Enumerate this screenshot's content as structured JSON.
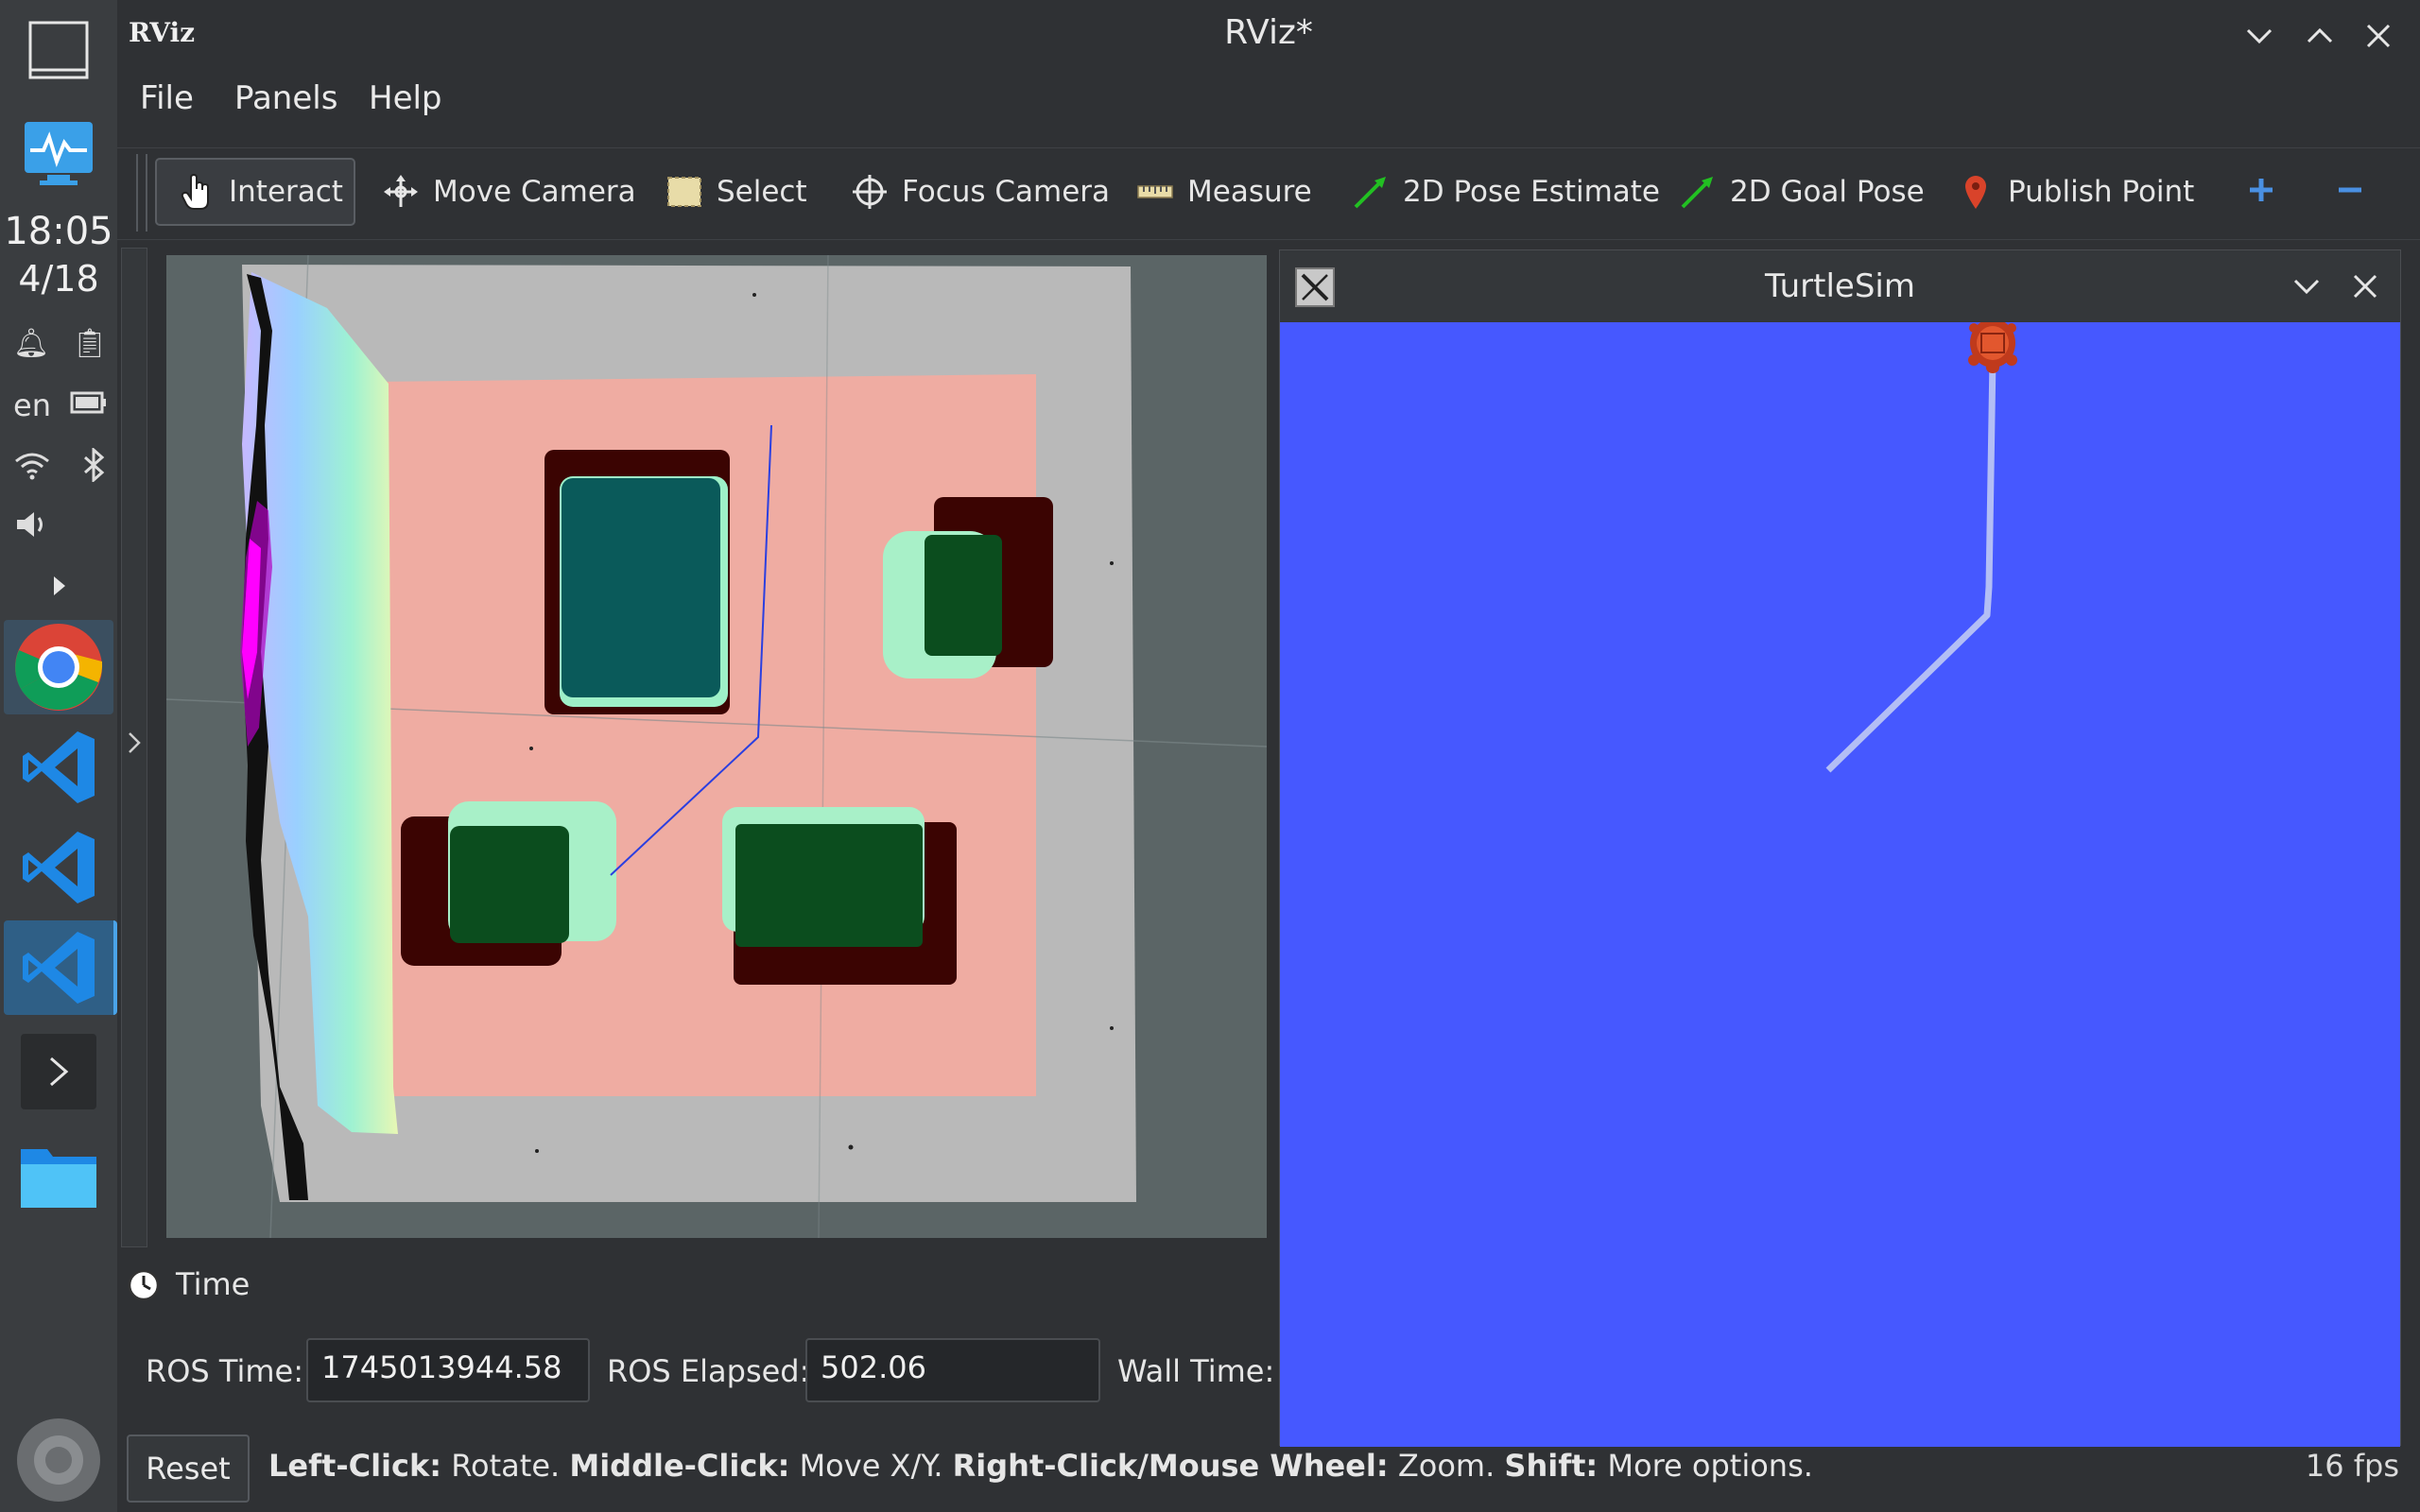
{
  "taskbar": {
    "clock_time": "18:05",
    "clock_date": "4/18",
    "language": "en",
    "apps": [
      "chrome-icon",
      "vscode-icon",
      "vscode-icon",
      "vscode-icon",
      "terminal-icon",
      "folder-icon"
    ]
  },
  "window": {
    "app_logo": "RViz",
    "title": "RViz*"
  },
  "menu": {
    "file": "File",
    "panels": "Panels",
    "help": "Help"
  },
  "toolbar": {
    "interact": "Interact",
    "move_camera": "Move Camera",
    "select": "Select",
    "focus_camera": "Focus Camera",
    "measure": "Measure",
    "pose_estimate": "2D Pose Estimate",
    "goal_pose": "2D Goal Pose",
    "publish_point": "Publish Point"
  },
  "time_panel": {
    "title": "Time",
    "ros_time_label": "ROS Time:",
    "ros_time_value": "1745013944.58",
    "ros_elapsed_label": "ROS Elapsed:",
    "ros_elapsed_value": "502.06",
    "wall_time_label": "Wall Time:"
  },
  "status": {
    "reset": "Reset",
    "hint_left_bold": "Left-Click:",
    "hint_left": " Rotate. ",
    "hint_middle_bold": "Middle-Click:",
    "hint_middle": " Move X/Y. ",
    "hint_right_bold": "Right-Click/Mouse Wheel:",
    "hint_right": " Zoom. ",
    "hint_shift_bold": "Shift:",
    "hint_shift": " More options.",
    "fps": "16 fps"
  },
  "turtlesim": {
    "title": "TurtleSim",
    "background_color": "#4658ff"
  },
  "colors": {
    "accent": "#4aa3e8",
    "map_floor": "#f0aea4",
    "map_obstacle": "#0a5a5a"
  }
}
